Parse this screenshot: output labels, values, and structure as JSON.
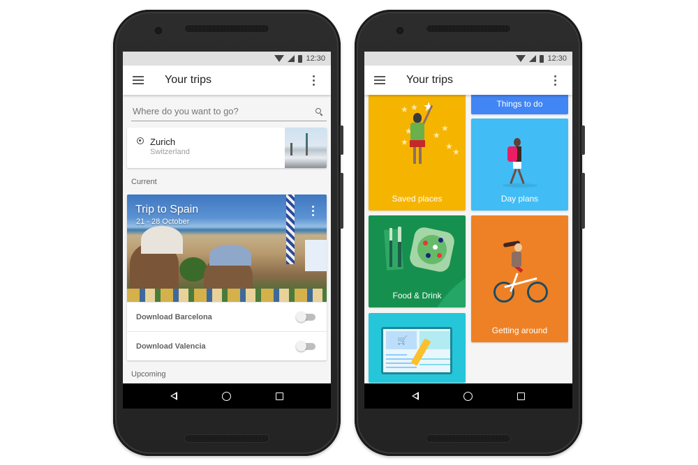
{
  "devices": {
    "left": {
      "status_bar": {
        "time": "12:30"
      },
      "app_bar": {
        "title": "Your trips"
      },
      "search": {
        "placeholder": "Where do you want to go?",
        "value": ""
      },
      "place_card": {
        "city": "Zurich",
        "country": "Switzerland"
      },
      "sections": {
        "current": "Current",
        "upcoming": "Upcoming"
      },
      "trip_card": {
        "title": "Trip to Spain",
        "dates": "21 - 28 October",
        "downloads": [
          {
            "label": "Download Barcelona",
            "enabled": false
          },
          {
            "label": "Download Valencia",
            "enabled": false
          }
        ]
      }
    },
    "right": {
      "status_bar": {
        "time": "12:30"
      },
      "app_bar": {
        "title": "Your trips"
      },
      "tiles": [
        {
          "label": "Saved places",
          "color": "#f5b400"
        },
        {
          "label": "Things to do",
          "color": "#4285f4"
        },
        {
          "label": "Day plans",
          "color": "#41bcf5"
        },
        {
          "label": "Food & Drink",
          "color": "#16904e"
        },
        {
          "label": "Getting around",
          "color": "#ee8125"
        },
        {
          "label": "",
          "color": "#26c6da"
        }
      ]
    }
  },
  "icons": {
    "status": [
      "wifi-icon",
      "signal-icon",
      "battery-icon"
    ],
    "app_bar": [
      "menu-icon",
      "more-vert-icon"
    ],
    "nav": [
      "back-icon",
      "home-icon",
      "recents-icon"
    ],
    "search": "search-icon",
    "place": "location-pin-icon"
  }
}
